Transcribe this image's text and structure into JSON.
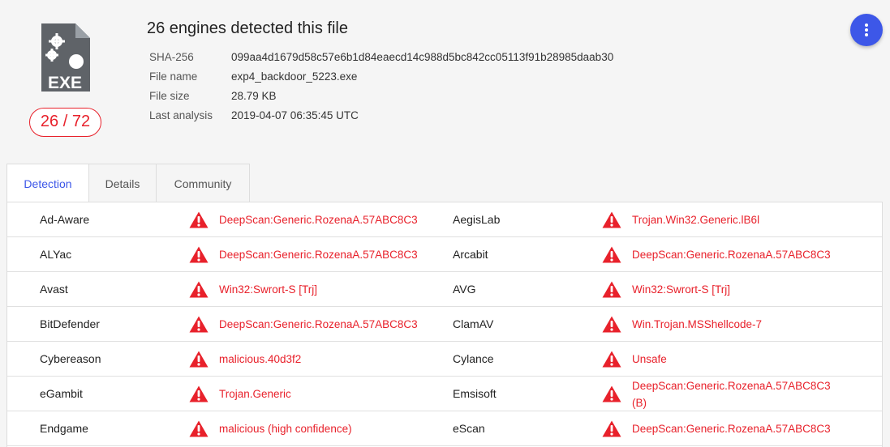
{
  "header": {
    "file_type_label": "EXE",
    "detection_ratio": "26 / 72",
    "title": "26 engines detected this file",
    "meta": [
      {
        "key": "SHA-256",
        "value": "099aa4d1679d58c57e6b1d84eaecd14c988d5bc842cc05113f91b28985daab30"
      },
      {
        "key": "File name",
        "value": "exp4_backdoor_5223.exe"
      },
      {
        "key": "File size",
        "value": "28.79 KB"
      },
      {
        "key": "Last analysis",
        "value": "2019-04-07 06:35:45 UTC"
      }
    ]
  },
  "tabs": [
    {
      "label": "Detection",
      "active": true
    },
    {
      "label": "Details",
      "active": false
    },
    {
      "label": "Community",
      "active": false
    }
  ],
  "detections": [
    {
      "left": {
        "engine": "Ad-Aware",
        "result": "DeepScan:Generic.RozenaA.57ABC8C3"
      },
      "right": {
        "engine": "AegisLab",
        "result": "Trojan.Win32.Generic.lB6l"
      }
    },
    {
      "left": {
        "engine": "ALYac",
        "result": "DeepScan:Generic.RozenaA.57ABC8C3"
      },
      "right": {
        "engine": "Arcabit",
        "result": "DeepScan:Generic.RozenaA.57ABC8C3"
      }
    },
    {
      "left": {
        "engine": "Avast",
        "result": "Win32:Swrort-S [Trj]"
      },
      "right": {
        "engine": "AVG",
        "result": "Win32:Swrort-S [Trj]"
      }
    },
    {
      "left": {
        "engine": "BitDefender",
        "result": "DeepScan:Generic.RozenaA.57ABC8C3"
      },
      "right": {
        "engine": "ClamAV",
        "result": "Win.Trojan.MSShellcode-7"
      }
    },
    {
      "left": {
        "engine": "Cybereason",
        "result": "malicious.40d3f2"
      },
      "right": {
        "engine": "Cylance",
        "result": "Unsafe"
      }
    },
    {
      "left": {
        "engine": "eGambit",
        "result": "Trojan.Generic"
      },
      "right": {
        "engine": "Emsisoft",
        "result": "DeepScan:Generic.RozenaA.57ABC8C3 (B)"
      }
    },
    {
      "left": {
        "engine": "Endgame",
        "result": "malicious (high confidence)"
      },
      "right": {
        "engine": "eScan",
        "result": "DeepScan:Generic.RozenaA.57ABC8C3"
      }
    }
  ],
  "colors": {
    "danger": "#e8212b",
    "accent": "#3d57e8"
  },
  "icons": {
    "file": "exe-file-icon",
    "warning": "warning-triangle-icon",
    "menu": "more-vert-icon"
  }
}
